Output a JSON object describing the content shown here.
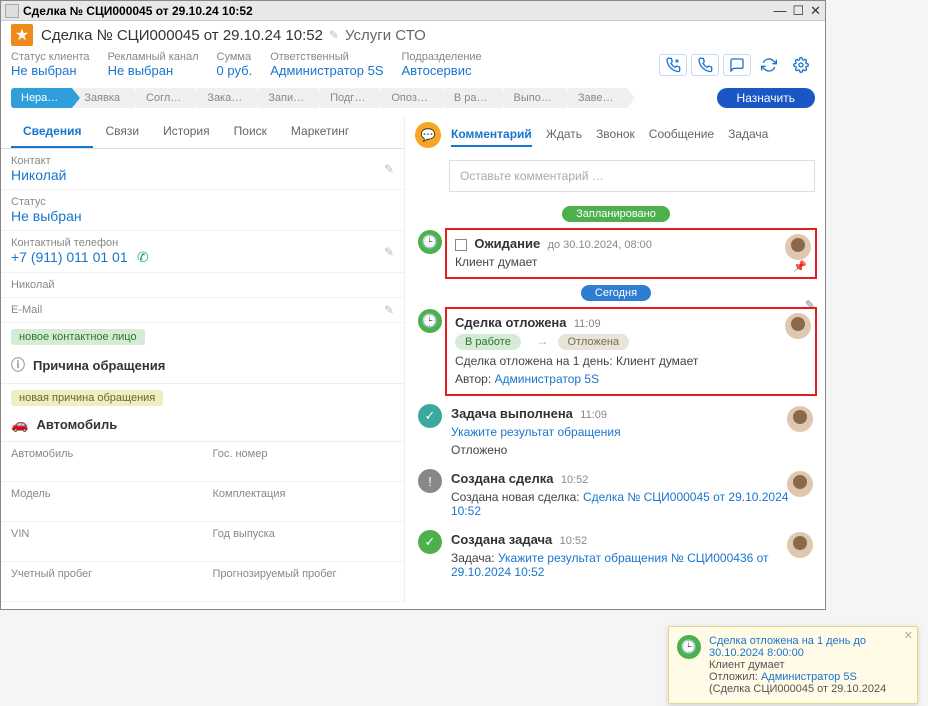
{
  "window": {
    "title": "Сделка № СЦИ000045 от 29.10.24 10:52"
  },
  "header": {
    "title": "Сделка № СЦИ000045 от 29.10.24 10:52",
    "subtitle": "Услуги СТО"
  },
  "meta": {
    "client_status": {
      "label": "Статус клиента",
      "value": "Не выбран"
    },
    "ad_channel": {
      "label": "Рекламный канал",
      "value": "Не выбран"
    },
    "sum": {
      "label": "Сумма",
      "value": "0 руб."
    },
    "responsible": {
      "label": "Ответственный",
      "value": "Администратор 5S"
    },
    "division": {
      "label": "Подразделение",
      "value": "Автосервис"
    }
  },
  "stages": [
    "Нера…",
    "Заявка",
    "Согл…",
    "Зака…",
    "Запи…",
    "Подг…",
    "Опоз…",
    "В ра…",
    "Выпо…",
    "Заве…"
  ],
  "assign_btn": "Назначить",
  "left_tabs": [
    "Сведения",
    "Связи",
    "История",
    "Поиск",
    "Маркетинг"
  ],
  "contact": {
    "label": "Контакт",
    "value": "Николай",
    "status_label": "Статус",
    "status_value": "Не выбран",
    "phone_label": "Контактный телефон",
    "phone_value": "+7 (911) 011 01 01",
    "name_under": "Николай",
    "email_label": "E-Mail"
  },
  "tags": {
    "new_contact": "новое контактное лицо",
    "new_reason": "новая причина обращения"
  },
  "sections": {
    "reason": "Причина обращения",
    "auto": "Автомобиль"
  },
  "auto_fields": {
    "car": "Автомобиль",
    "gos": "Гос. номер",
    "model": "Модель",
    "kompl": "Комплектация",
    "vin": "VIN",
    "year": "Год выпуска",
    "mileage": "Учетный пробег",
    "predicted": "Прогнозируемый пробег"
  },
  "rp_tabs": [
    "Комментарий",
    "Ждать",
    "Звонок",
    "Сообщение",
    "Задача"
  ],
  "comment_placeholder": "Оставьте комментарий …",
  "dividers": {
    "planned": "Запланировано",
    "today": "Сегодня"
  },
  "items": {
    "waiting": {
      "title": "Ожидание",
      "until": "до 30.10.2024, 08:00",
      "body": "Клиент думает"
    },
    "postponed": {
      "title": "Сделка отложена",
      "time": "11:09",
      "pill_from": "В работе",
      "pill_to": "Отложена",
      "line1": "Сделка отложена на 1 день: Клиент думает",
      "author_label": "Автор: ",
      "author": "Администратор 5S"
    },
    "task_done": {
      "title": "Задача выполнена",
      "time": "11:09",
      "link": "Укажите результат обращения",
      "result": "Отложено"
    },
    "deal_created": {
      "title": "Создана сделка",
      "time": "10:52",
      "text": "Создана новая сделка: ",
      "link": "Сделка № СЦИ000045 от 29.10.2024 10:52"
    },
    "task_created": {
      "title": "Создана задача",
      "time": "10:52",
      "text": "Задача: ",
      "link": "Укажите результат обращения № СЦИ000436 от 29.10.2024 10:52"
    }
  },
  "toast": {
    "line1": "Сделка отложена на 1 день до 30.10.2024 8:00:00",
    "line2": "Клиент думает",
    "line3_label": "Отложил: ",
    "line3_link": "Администратор 5S",
    "line4": "(Сделка СЦИ000045 от 29.10.2024"
  }
}
